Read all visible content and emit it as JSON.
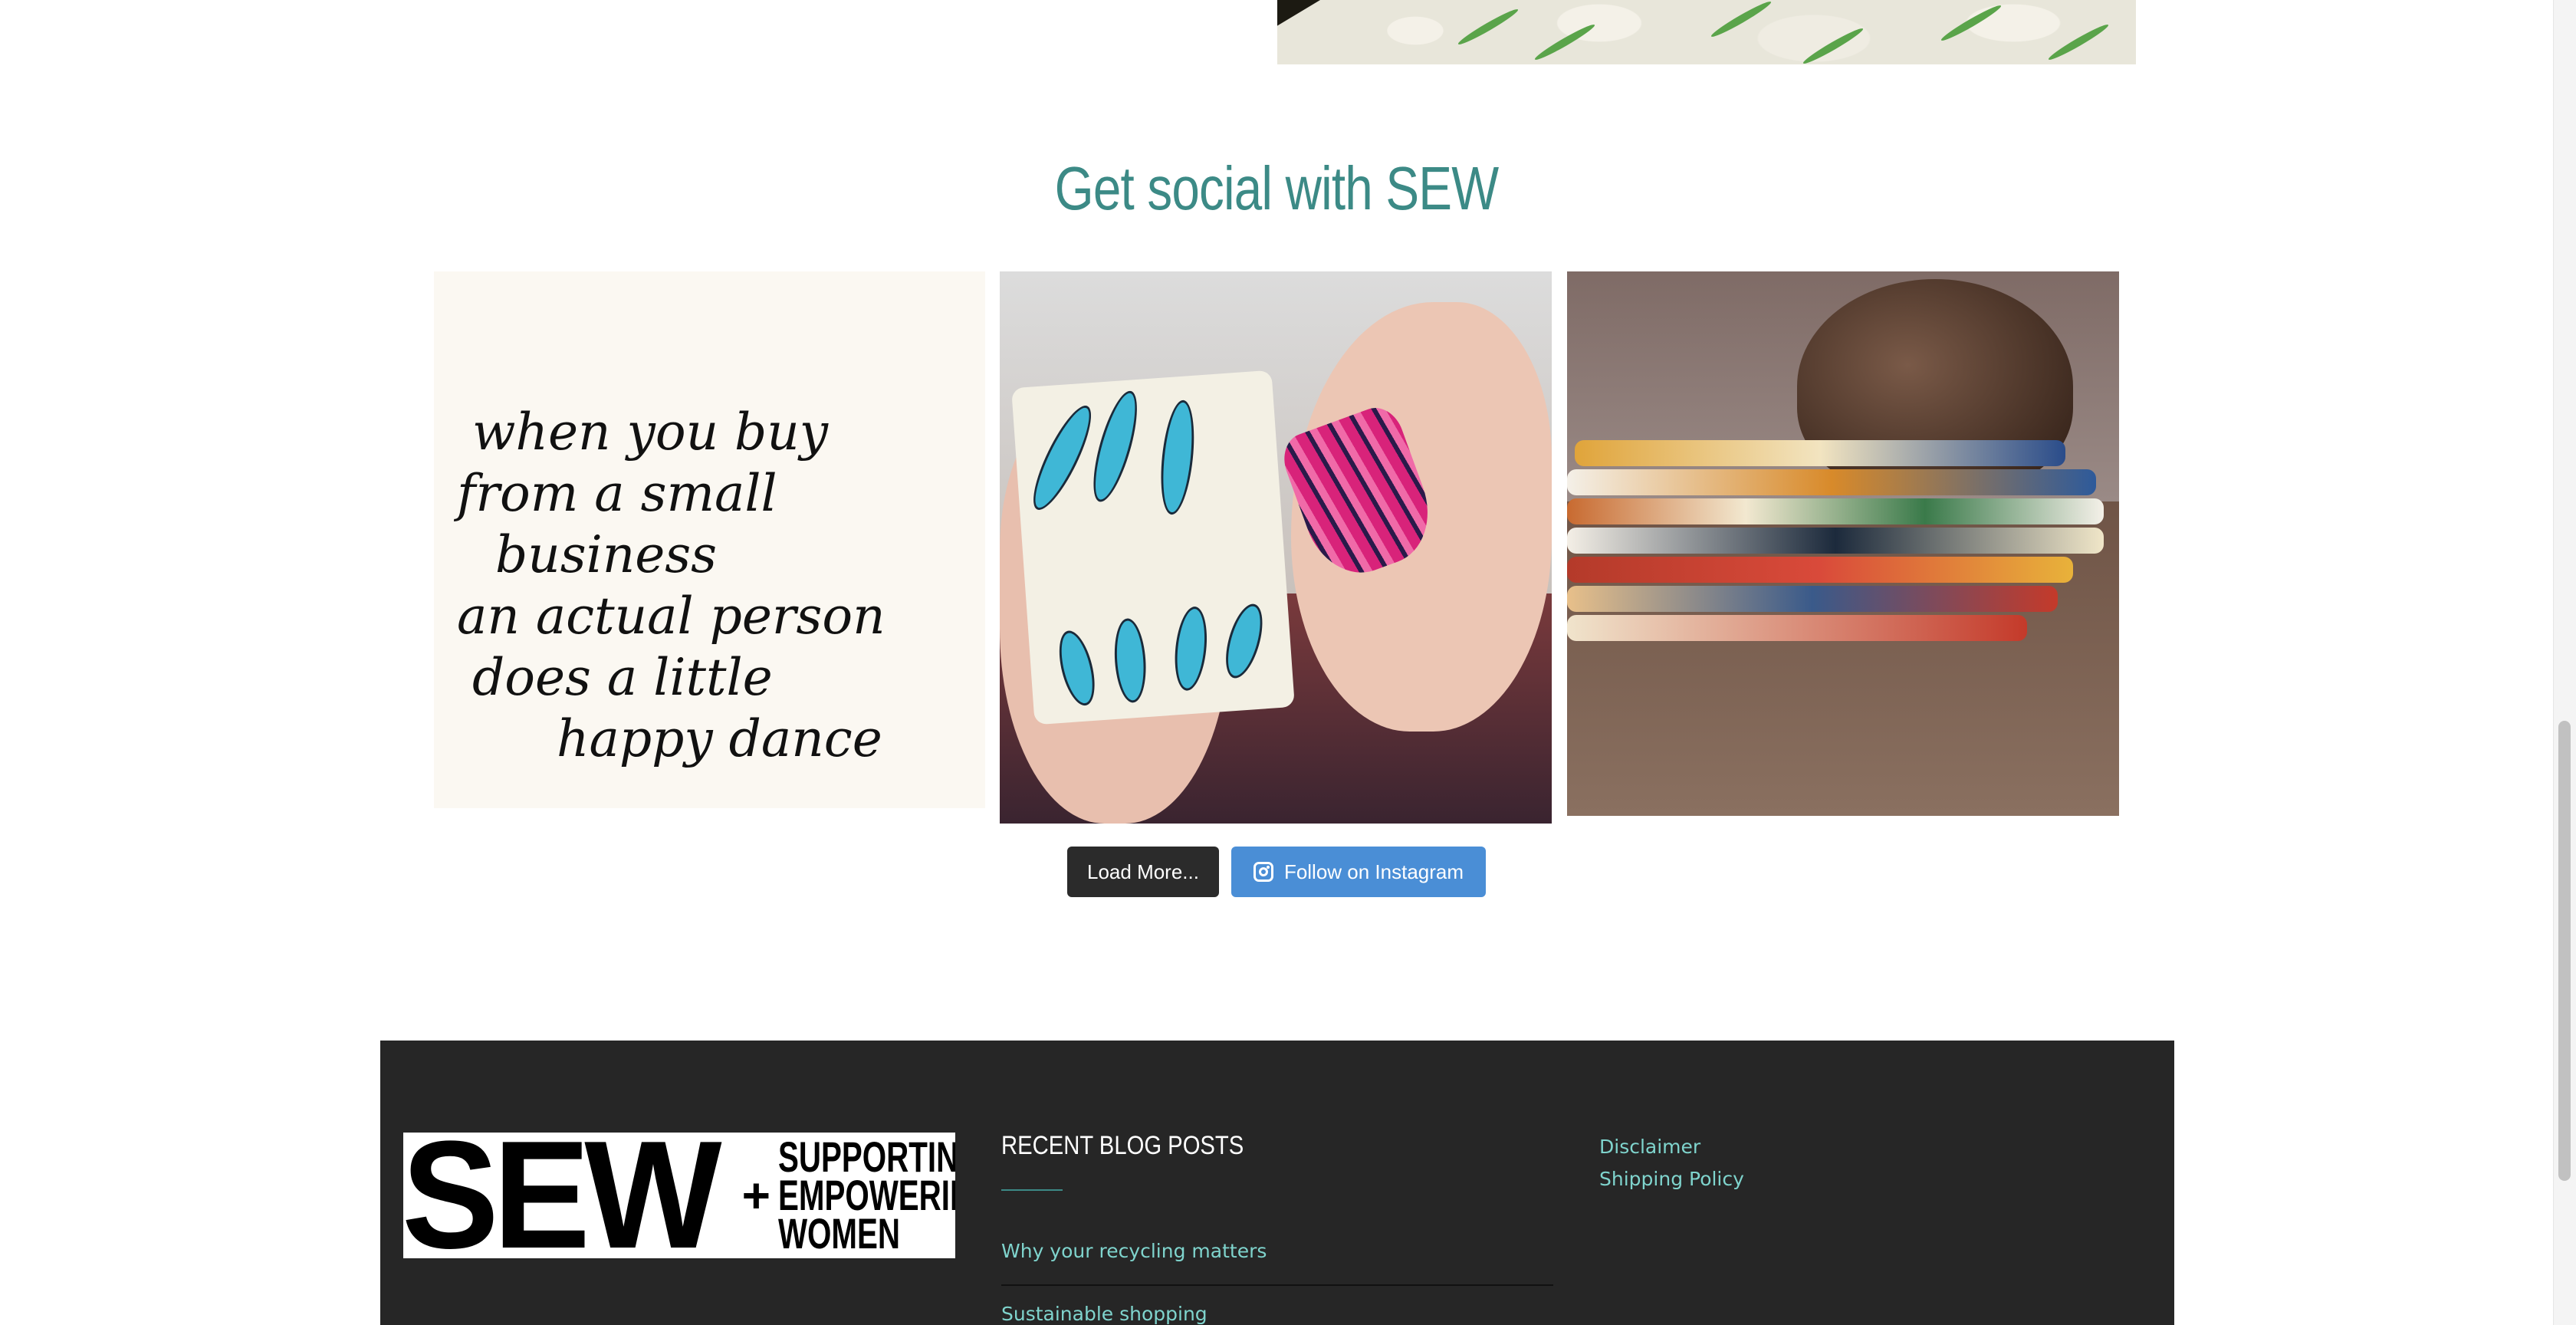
{
  "top_image": {
    "alt": ""
  },
  "social": {
    "heading": "Get social with SEW",
    "posts": [
      {
        "quote_lines": [
          "when you buy",
          "from a small",
          "business",
          "an actual person",
          "does a little",
          "happy dance"
        ]
      },
      {},
      {}
    ],
    "load_more_label": "Load More...",
    "follow_label": "Follow on Instagram"
  },
  "footer": {
    "logo": {
      "mark": "SEW",
      "plus": "+",
      "lines": [
        "SUPPORTING",
        "EMPOWERING",
        "WOMEN"
      ]
    },
    "recent_posts_title": "RECENT BLOG POSTS",
    "recent_posts": [
      "Why your recycling matters",
      "Sustainable shopping"
    ],
    "links": [
      "Disclaimer",
      "Shipping Policy"
    ]
  },
  "colors": {
    "heading": "#3c8a86",
    "link": "#7fd4cd",
    "follow_button": "#4a8ed6",
    "load_button": "#2b2b2b",
    "footer_bg": "#262626"
  }
}
